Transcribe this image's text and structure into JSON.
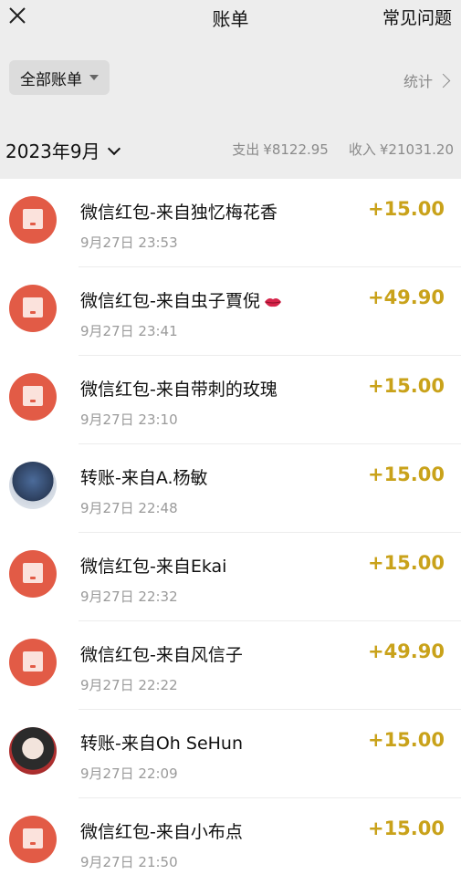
{
  "header": {
    "title": "账单",
    "faq_label": "常见问题"
  },
  "filter": {
    "label": "全部账单",
    "stats_label": "统计"
  },
  "month": {
    "label": "2023年9月",
    "expense_label": "支出",
    "expense_value": "¥8122.95",
    "income_label": "收入",
    "income_value": "¥21031.20"
  },
  "colors": {
    "amount": "#c9a21a",
    "red_packet": "#e25b46"
  },
  "transactions": [
    {
      "icon": "red-packet-icon",
      "title": "微信红包-来自独忆梅花香",
      "time": "9月27日 23:53",
      "amount": "+15.00"
    },
    {
      "icon": "red-packet-icon",
      "title": "微信红包-来自虫子賈倪",
      "time": "9月27日 23:41",
      "amount": "+49.90",
      "emoji": "lips-emoji"
    },
    {
      "icon": "red-packet-icon",
      "title": "微信红包-来自带刺的玫瑰",
      "time": "9月27日 23:10",
      "amount": "+15.00"
    },
    {
      "icon": "user-avatar",
      "title": "转账-来自A.杨敏",
      "time": "9月27日 22:48",
      "amount": "+15.00"
    },
    {
      "icon": "red-packet-icon",
      "title": "微信红包-来自Ekai",
      "time": "9月27日 22:32",
      "amount": "+15.00"
    },
    {
      "icon": "red-packet-icon",
      "title": "微信红包-来自风信子",
      "time": "9月27日 22:22",
      "amount": "+49.90"
    },
    {
      "icon": "user-avatar",
      "title": "转账-来自Oh SeHun",
      "time": "9月27日 22:09",
      "amount": "+15.00"
    },
    {
      "icon": "red-packet-icon",
      "title": "微信红包-来自小布点",
      "time": "9月27日 21:50",
      "amount": "+15.00"
    }
  ]
}
